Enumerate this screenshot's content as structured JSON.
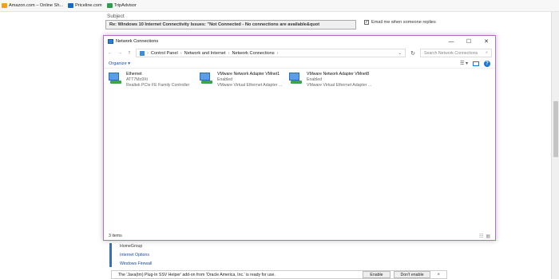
{
  "bookmarks": [
    {
      "label": "Amazon.com – Online Sh...",
      "color": "#f0a020",
      "icon": "amazon-icon"
    },
    {
      "label": "Priceline.com",
      "color": "#1866c8",
      "icon": "priceline-icon"
    },
    {
      "label": "TripAdvisor",
      "color": "#2e9e4e",
      "icon": "tripadvisor-icon"
    }
  ],
  "page": {
    "subject_label": "Subject",
    "subject_value": "Re: Windows 10 Internet Connectivity Issues: \"Not Connected - No connections are available&quot",
    "email_option": "Email me when someone replies",
    "email_checked": true,
    "control_panel_links": [
      "HomeGroup",
      "Internet Options",
      "Windows Firewall"
    ]
  },
  "window": {
    "title": "Network Connections",
    "controls": {
      "minimize": "—",
      "maximize": "☐",
      "close": "✕"
    },
    "nav": {
      "back": "←",
      "forward": "→",
      "up": "↑"
    },
    "breadcrumb": [
      "Control Panel",
      "Network and Internet",
      "Network Connections"
    ],
    "search_placeholder": "Search Network Connections",
    "organize_label": "Organize ▾",
    "adapters": [
      {
        "name": "Ethernet",
        "status": "ATT7Mx9Xt",
        "device": "Realtek PCIe FE Family Controller"
      },
      {
        "name": "VMware Network Adapter VMnet1",
        "status": "Enabled",
        "device": "VMware Virtual Ethernet Adapter ..."
      },
      {
        "name": "VMware Network Adapter VMnet8",
        "status": "Enabled",
        "device": "VMware Virtual Ethernet Adapter ..."
      }
    ],
    "status_bar": "3 items"
  },
  "notification": {
    "message": "The 'Java(tm) Plug-In SSV Helper' add-on from 'Oracle America, Inc.' is ready for use.",
    "enable_label": "Enable",
    "dont_enable_label": "Don't enable",
    "close": "×"
  },
  "colors": {
    "window_border": "#b46cc6",
    "link_blue": "#1a4aa0",
    "accent": "#1e76d8"
  }
}
